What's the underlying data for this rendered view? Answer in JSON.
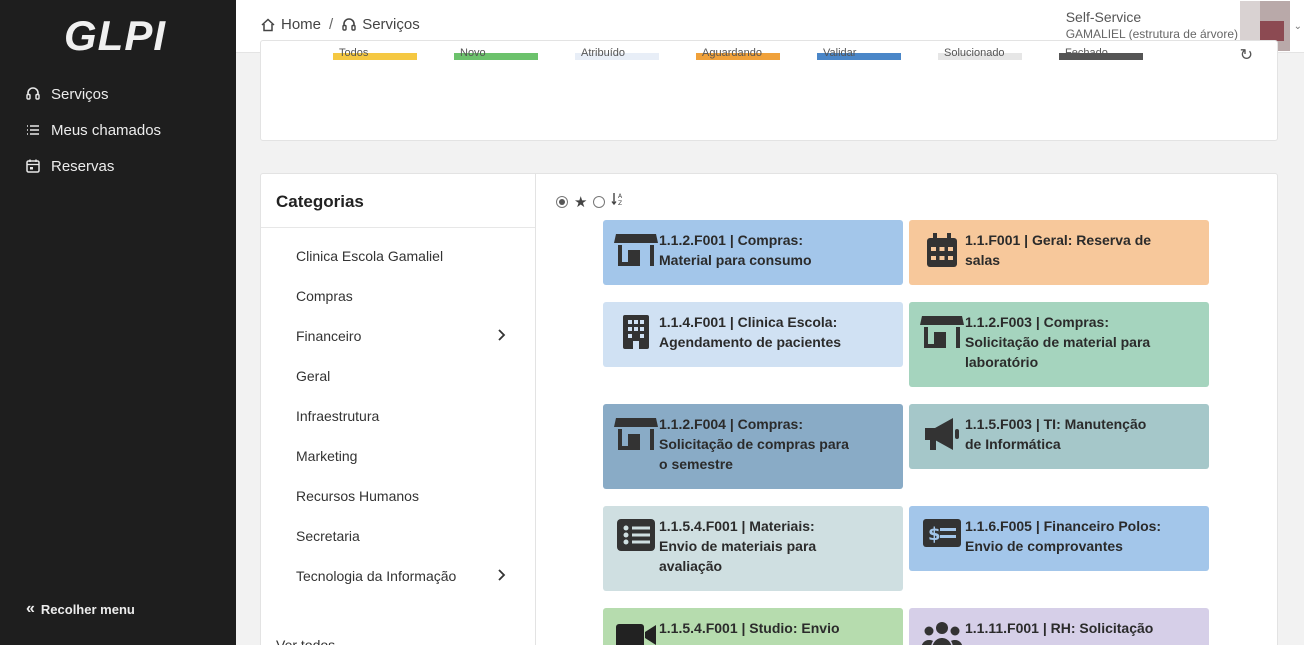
{
  "sidebar": {
    "logo": "GLPI",
    "items": [
      {
        "label": "Serviços",
        "icon": "headset-icon"
      },
      {
        "label": "Meus chamados",
        "icon": "list-icon"
      },
      {
        "label": "Reservas",
        "icon": "calendar-icon"
      }
    ],
    "collapse_label": "Recolher menu"
  },
  "header": {
    "breadcrumb": [
      {
        "label": "Home",
        "icon": "home-icon"
      },
      {
        "label": "Serviços",
        "icon": "headset-icon"
      }
    ],
    "profile_name": "Self-Service",
    "profile_entity": "GAMALIEL (estrutura de árvore)"
  },
  "ticket_statuses": [
    {
      "label": "Todos",
      "color": "#f5c842"
    },
    {
      "label": "Novo",
      "color": "#6cc26c"
    },
    {
      "label": "Atribuído",
      "color": "#e8eef7"
    },
    {
      "label": "Aguardando",
      "color": "#f0a13a"
    },
    {
      "label": "Validar",
      "color": "#4a86c8"
    },
    {
      "label": "Solucionado",
      "color": "#e6e6e6"
    },
    {
      "label": "Fechado",
      "color": "#555555"
    }
  ],
  "categories": {
    "title": "Categorias",
    "items": [
      {
        "label": "Clinica Escola Gamaliel",
        "has_children": false
      },
      {
        "label": "Compras",
        "has_children": false
      },
      {
        "label": "Financeiro",
        "has_children": true
      },
      {
        "label": "Geral",
        "has_children": false
      },
      {
        "label": "Infraestrutura",
        "has_children": false
      },
      {
        "label": "Marketing",
        "has_children": false
      },
      {
        "label": "Recursos Humanos",
        "has_children": false
      },
      {
        "label": "Secretaria",
        "has_children": false
      },
      {
        "label": "Tecnologia da Informação",
        "has_children": true
      }
    ],
    "view_all": "Ver todos"
  },
  "forms": [
    {
      "line1": "1.1.2.F001 | Compras:",
      "line2": "Material para consumo",
      "line3": "",
      "icon": "store-icon",
      "color": "#a3c6ea"
    },
    {
      "line1": "1.1.F001 | Geral: Reserva de",
      "line2": "salas",
      "line3": "",
      "icon": "calendar-icon",
      "color": "#f7c89b"
    },
    {
      "line1": "1.1.4.F001 | Clinica Escola:",
      "line2": "Agendamento de pacientes",
      "line3": "",
      "icon": "building-icon",
      "color": "#d0e1f3"
    },
    {
      "line1": "1.1.2.F003 | Compras:",
      "line2": "Solicitação de material para",
      "line3": "laboratório",
      "icon": "store-icon",
      "color": "#a5d4be"
    },
    {
      "line1": "1.1.2.F004 | Compras:",
      "line2": "Solicitação de compras para",
      "line3": "o semestre",
      "icon": "store-icon",
      "color": "#89abc6"
    },
    {
      "line1": "1.1.5.F003 | TI: Manutenção",
      "line2": "de Informática",
      "line3": "",
      "icon": "megaphone-icon",
      "color": "#a5c7c9"
    },
    {
      "line1": "1.1.5.4.F001 | Materiais:",
      "line2": "Envio de materiais para",
      "line3": "avaliação",
      "icon": "list-alt-icon",
      "color": "#cfdfe1"
    },
    {
      "line1": "1.1.6.F005 | Financeiro Polos:",
      "line2": "Envio de comprovantes",
      "line3": "",
      "icon": "money-icon",
      "color": "#a3c6ea"
    },
    {
      "line1": "1.1.5.4.F001 | Studio: Envio",
      "line2": "",
      "line3": "",
      "icon": "video-icon",
      "color": "#b6dcae"
    },
    {
      "line1": "1.1.11.F001 | RH: Solicitação",
      "line2": "",
      "line3": "",
      "icon": "users-icon",
      "color": "#d6cfe8"
    }
  ]
}
